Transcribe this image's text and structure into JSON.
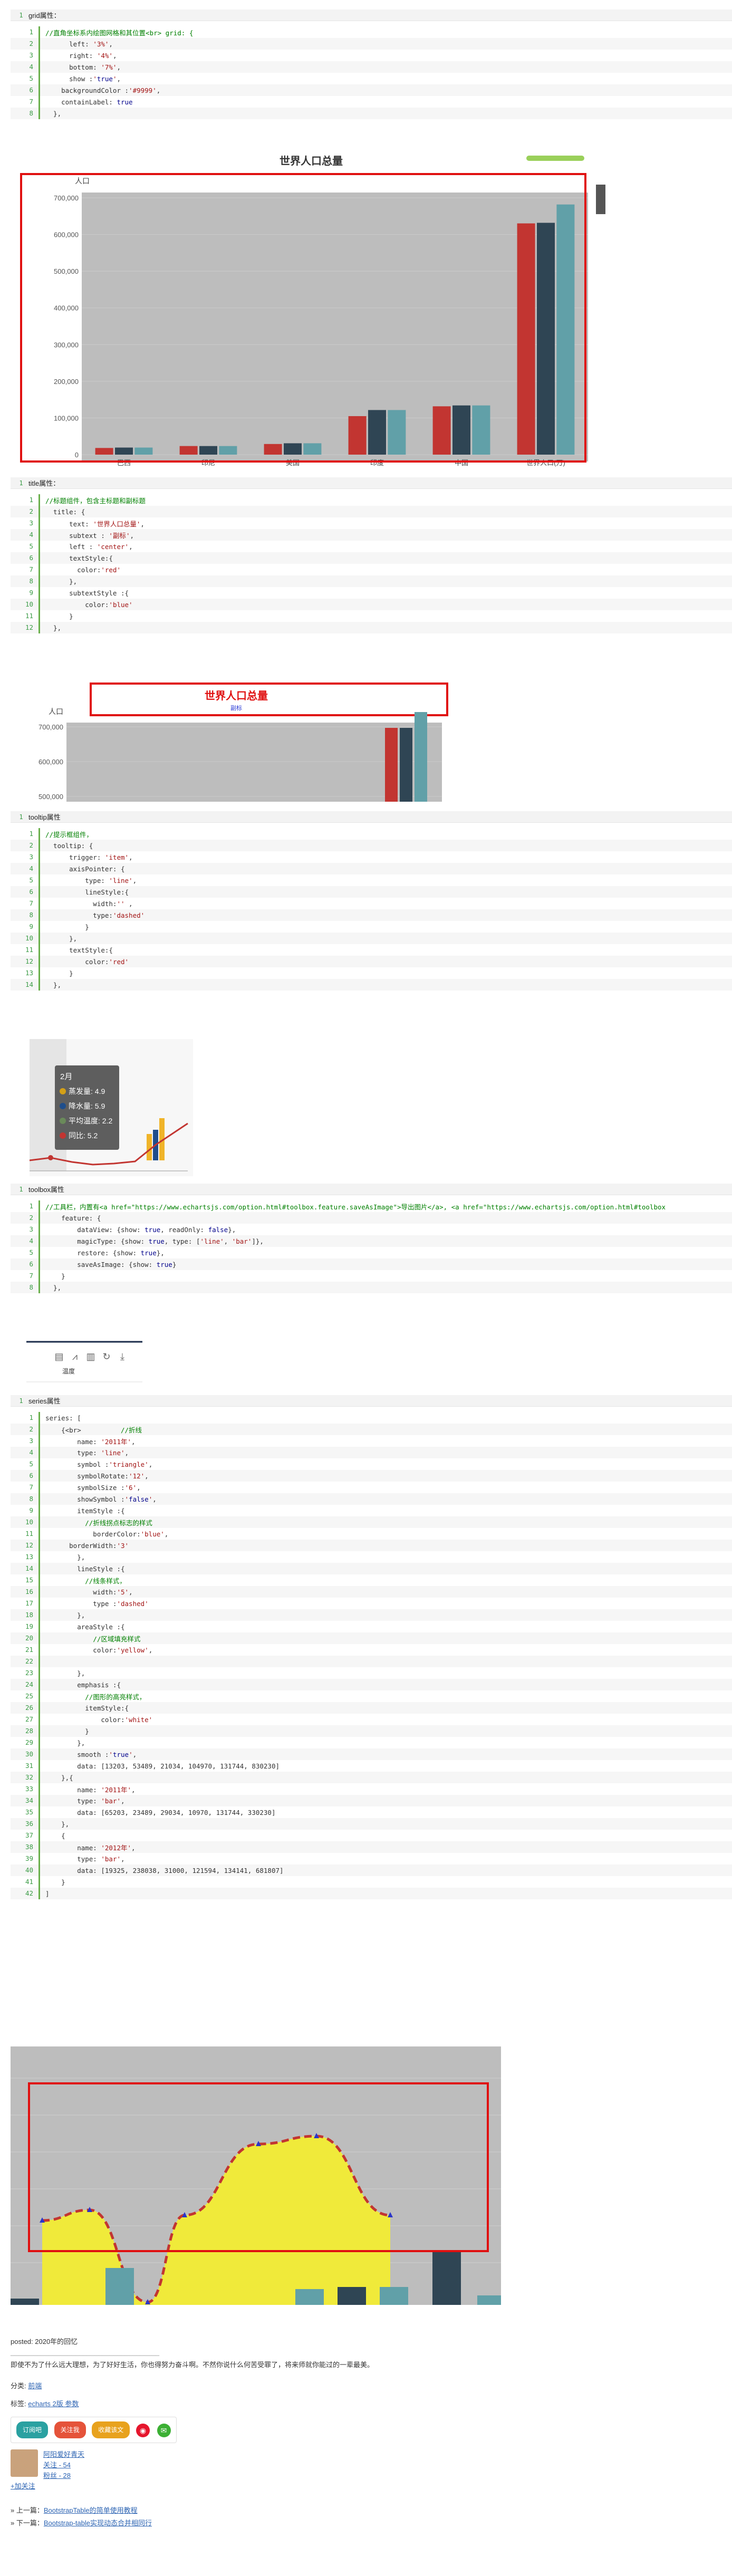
{
  "blocks": [
    {
      "title": "grid属性：",
      "lines": [
        "//直角坐标系内绘图网格和其位置<br> grid: {",
        "      left: '3%',",
        "      right: '4%',",
        "      bottom: '7%',",
        "      show :'true',",
        "    backgroundColor :'#9999',",
        "    containLabel: true",
        "  },"
      ]
    },
    {
      "title": "title属性：",
      "lines": [
        "//标题组件，包含主标题和副标题",
        "  title: {",
        "      text: '世界人口总量',",
        "      subtext : '副标',",
        "      left : 'center',",
        "      textStyle:{",
        "        color:'red'",
        "      },",
        "      subtextStyle :{",
        "          color:'blue'",
        "      }",
        "  },"
      ]
    },
    {
      "title": "tooltip属性",
      "lines": [
        "//提示框组件，",
        "  tooltip: {",
        "      trigger: 'item',",
        "      axisPointer: {",
        "          type: 'line',",
        "          lineStyle:{",
        "            width:'' ,",
        "            type:'dashed'",
        "          }",
        "      },",
        "      textStyle:{",
        "          color:'red'",
        "      }",
        "  },"
      ]
    },
    {
      "title": "toolbox属性",
      "lines": [
        "//工具栏，内置有<a href=\"https://www.echartsjs.com/option.html#toolbox.feature.saveAsImage\">导出图片</a>, <a href=\"https://www.echartsjs.com/option.html#toolbox",
        "    feature: {",
        "        dataView: {show: true, readOnly: false},",
        "        magicType: {show: true, type: ['line', 'bar']},",
        "        restore: {show: true},",
        "        saveAsImage: {show: true}",
        "    }",
        "  },"
      ]
    },
    {
      "title": "series属性",
      "lines": [
        "series: [",
        "    {<br>          //折线",
        "        name: '2011年',",
        "        type: 'line',",
        "        symbol :'triangle',",
        "        symbolRotate:'12',",
        "        symbolSize :'6',",
        "        showSymbol :'false',",
        "        itemStyle :{",
        "          //折线拐点标志的样式",
        "            borderColor:'blue',",
        "      borderWidth:'3'",
        "        },",
        "        lineStyle :{",
        "          //线条样式，",
        "            width:'5',",
        "            type :'dashed'",
        "        },",
        "        areaStyle :{",
        "            //区域填充样式",
        "            color:'yellow',",
        "",
        "        },",
        "        emphasis :{",
        "          //图形的高亮样式，",
        "          itemStyle:{",
        "              color:'white'",
        "          }",
        "        },",
        "        smooth :'true',",
        "        data: [13203, 53489, 21034, 104970, 131744, 830230]",
        "    },{",
        "        name: '2011年',",
        "        type: 'bar',",
        "        data: [65203, 23489, 29034, 10970, 131744, 330230]",
        "    },",
        "    {",
        "        name: '2012年',",
        "        type: 'bar',",
        "        data: [19325, 238038, 31000, 121594, 134141, 681807]",
        "    }",
        "]"
      ]
    }
  ],
  "chart_data": [
    {
      "type": "bar",
      "title": "世界人口总量",
      "ylabel": "人口",
      "ylim": [
        0,
        700000
      ],
      "yticks": [
        "0",
        "100,000",
        "200,000",
        "300,000",
        "400,000",
        "500,000",
        "600,000",
        "700,000"
      ],
      "categories": [
        "巴西",
        "印尼",
        "美国",
        "印度",
        "中国",
        "世界人口(万)"
      ],
      "series": [
        {
          "color": "#c23531",
          "values": [
            18203,
            23489,
            29034,
            104970,
            131744,
            630230
          ]
        },
        {
          "color": "#2f4554",
          "values": [
            19325,
            23438,
            31000,
            121594,
            134141,
            631807
          ]
        },
        {
          "color": "#61a0a8",
          "values": [
            19325,
            23438,
            31000,
            121594,
            134141,
            681807
          ]
        }
      ]
    },
    {
      "type": "bar",
      "title": "世界人口总量",
      "subtitle": "副标",
      "ylabel": "人口",
      "yticks": [
        "700,000",
        "600,000",
        "500,000"
      ]
    },
    {
      "type": "line",
      "tooltip": {
        "title": "2月",
        "items": [
          {
            "label": "蒸发量",
            "value": "4.9",
            "color": "#d4a017"
          },
          {
            "label": "降水量",
            "value": "5.9",
            "color": "#1f4e8c"
          },
          {
            "label": "平均温度",
            "value": "2.2",
            "color": "#6a8a5a"
          },
          {
            "label": "同比",
            "value": "5.2",
            "color": "#c23531"
          }
        ]
      }
    },
    {
      "type": "toolbox",
      "labels": [
        "温度"
      ]
    },
    {
      "type": "area",
      "line_values": [
        13203,
        53489,
        21034,
        104970,
        131744,
        83023
      ],
      "bars": [
        {
          "color": "#2f4554",
          "values": [
            2000,
            3000,
            1500,
            3000,
            3500,
            8000
          ]
        },
        {
          "color": "#61a0a8",
          "values": [
            1000,
            6500,
            1500,
            3000,
            3000,
            1000
          ]
        }
      ]
    }
  ],
  "footer": {
    "posted": "posted:   2020年的回忆",
    "sep": "_______________________________________",
    "quote": "即使不为了什么远大理想，为了好好生活，你也得努力奋斗啊。不然你说什么何苦受罪了，将来师就你能过的一辈最美。",
    "category_label": "分类:",
    "category": "前端",
    "tags_label": "标签:",
    "tags": "echarts 2版 参数",
    "buttons": [
      "订阅吧",
      "关注我",
      "收藏该文",
      "",
      ""
    ],
    "author": "阿阳爱好青天",
    "follow": "关注 - 54",
    "fans": "粉丝 - 28",
    "add_follow": "+加关注",
    "prev_label": "» 上一篇：",
    "prev": "BootstrapTable的简单使用教程",
    "next_label": "» 下一篇：",
    "next": "Bootstrap-table实现动态合并相同行"
  }
}
